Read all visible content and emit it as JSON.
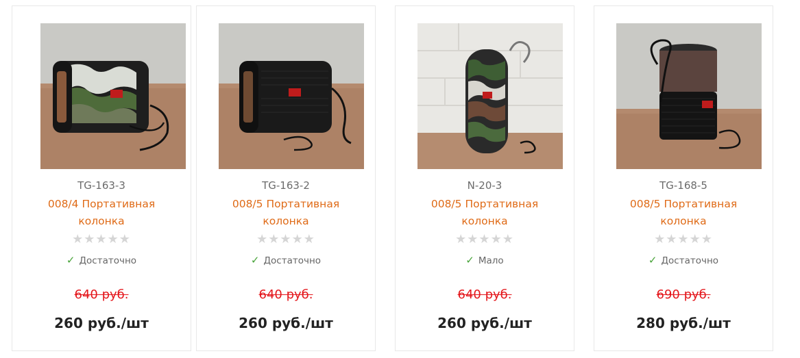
{
  "products": [
    {
      "sku": "TG-163-3",
      "title": "008/4 Портативная колонка",
      "rating": 0,
      "rating_max": 5,
      "stock": "Достаточно",
      "old_price": "640 руб.",
      "price": "260 руб./шт",
      "image": "speaker-camo-rect"
    },
    {
      "sku": "TG-163-2",
      "title": "008/5 Портативная колонка",
      "rating": 0,
      "rating_max": 5,
      "stock": "Достаточно",
      "old_price": "640 руб.",
      "price": "260 руб./шт",
      "image": "speaker-black-rect"
    },
    {
      "sku": "N-20-3",
      "title": "008/5 Портативная колонка",
      "rating": 0,
      "rating_max": 5,
      "stock": "Мало",
      "old_price": "640 руб.",
      "price": "260 руб./шт",
      "image": "speaker-camo-cylinder"
    },
    {
      "sku": "TG-168-5",
      "title": "008/5 Портативная колонка",
      "rating": 0,
      "rating_max": 5,
      "stock": "Достаточно",
      "old_price": "690 руб.",
      "price": "280 руб./шт",
      "image": "speaker-black-lantern"
    }
  ],
  "colors": {
    "title": "#df6a16",
    "old_price": "#e4161b",
    "price": "#222222",
    "stock_check": "#47a339",
    "star_empty": "#d5d5d5"
  },
  "icons": {
    "star": "star-icon",
    "check": "check-icon"
  }
}
